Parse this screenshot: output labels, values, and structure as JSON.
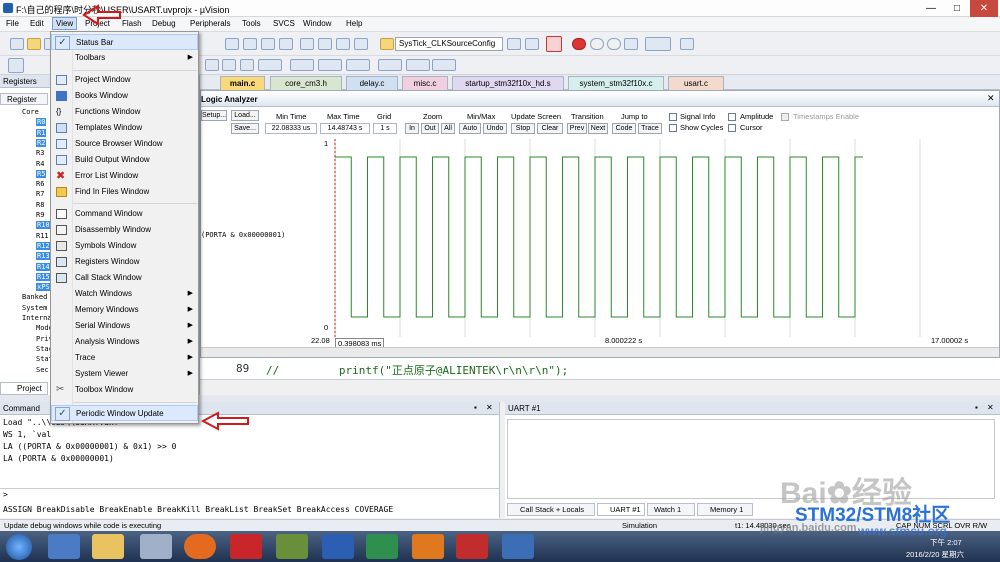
{
  "window": {
    "title": "F:\\自己的程序\\时分秒\\USER\\USART.uvprojx - µVision"
  },
  "menubar": [
    "File",
    "Edit",
    "View",
    "Project",
    "Flash",
    "Debug",
    "Peripherals",
    "Tools",
    "SVCS",
    "Window",
    "Help"
  ],
  "toolbar": {
    "target_combo": "SysTick_CLKSourceConfig"
  },
  "registers": {
    "header": "Registers",
    "column": "Register",
    "rows": [
      "Core",
      "R0",
      "R1",
      "R2",
      "R3",
      "R4",
      "R5",
      "R6",
      "R7",
      "R8",
      "R9",
      "R10",
      "R11",
      "R12",
      "R13",
      "R14",
      "R15",
      "xPSR",
      "Banked",
      "System",
      "Internal",
      "Mode",
      "Priv",
      "Stack",
      "Stat",
      "Sec"
    ],
    "project_tab": "Project"
  },
  "file_tabs": [
    "main.c",
    "core_cm3.h",
    "delay.c",
    "misc.c",
    "startup_stm32f10x_hd.s",
    "system_stm32f10x.c",
    "usart.c"
  ],
  "logic_analyzer": {
    "title": "Logic Analyzer",
    "setup": "Setup...",
    "load": "Load...",
    "save": "Save...",
    "min_time_label": "Min Time",
    "min_time": "22.08333 us",
    "max_time_label": "Max Time",
    "max_time": "14.48743 s",
    "grid_label": "Grid",
    "grid": "1 s",
    "zoom_label": "Zoom",
    "zoom_in": "In",
    "zoom_out": "Out",
    "zoom_all": "All",
    "minmax_label": "Min/Max",
    "auto": "Auto",
    "undo": "Undo",
    "update_label": "Update Screen",
    "stop": "Stop",
    "clear": "Clear",
    "transition_label": "Transition",
    "prev": "Prev",
    "next": "Next",
    "jump_label": "Jump to",
    "code": "Code",
    "trace": "Trace",
    "signal_info": "Signal Info",
    "show_cycles": "Show Cycles",
    "amplitude": "Amplitude",
    "cursor": "Cursor",
    "timestamps": "Timestamps Enable",
    "signal_name": "(PORTA & 0x00000001)",
    "y_high": "1",
    "y_low": "0",
    "x_start": "22.08",
    "x_cursor": "0.398083 ms",
    "x_mid": "8.000222 s",
    "x_end": "17.00002 s"
  },
  "code": {
    "line_no": "89",
    "text": "//         printf(\"正点原子@ALIENTEK\\r\\n\\r\\n\");"
  },
  "command": {
    "header": "Command",
    "lines": [
      "Load \"..\\\\OBJ\\\\USART.axf\"",
      "WS 1, `val",
      "LA ((PORTA & 0x00000001) & 0x1) >> 0",
      "LA (PORTA & 0x00000001)"
    ],
    "prompt": ">",
    "autocomplete": "ASSIGN BreakDisable BreakEnable BreakKill BreakList BreakSet BreakAccess COVERAGE"
  },
  "uart": {
    "header": "UART #1",
    "tabs": [
      "Call Stack + Locals",
      "UART #1",
      "Watch 1",
      "Memory 1"
    ]
  },
  "status": {
    "hint": "Update debug windows while code is executing",
    "mode": "Simulation",
    "time": "t1: 14.48030 sec",
    "flags": "CAP NUM SCRL OVR R/W"
  },
  "taskbar": {
    "clock_time": "下午 2:07",
    "clock_date": "2016/2/20 星期六"
  },
  "view_menu": {
    "items": [
      {
        "label": "Status Bar",
        "checked": true
      },
      {
        "label": "Toolbars",
        "submenu": true
      },
      {
        "label": "Project Window"
      },
      {
        "label": "Books Window"
      },
      {
        "label": "Functions Window"
      },
      {
        "label": "Templates Window"
      },
      {
        "label": "Source Browser Window"
      },
      {
        "label": "Build Output Window"
      },
      {
        "label": "Error List Window"
      },
      {
        "label": "Find In Files Window"
      },
      {
        "label": "Command Window"
      },
      {
        "label": "Disassembly Window"
      },
      {
        "label": "Symbols Window"
      },
      {
        "label": "Registers Window"
      },
      {
        "label": "Call Stack Window"
      },
      {
        "label": "Watch Windows",
        "submenu": true
      },
      {
        "label": "Memory Windows",
        "submenu": true
      },
      {
        "label": "Serial Windows",
        "submenu": true
      },
      {
        "label": "Analysis Windows",
        "submenu": true
      },
      {
        "label": "Trace",
        "submenu": true
      },
      {
        "label": "System Viewer",
        "submenu": true
      },
      {
        "label": "Toolbox Window"
      },
      {
        "label": "Periodic Window Update",
        "checked": true
      }
    ]
  },
  "watermark": {
    "brand": "Bai",
    "brand2": "经验",
    "site": "STM32/STM8社区",
    "url": "jingyan.baidu.com",
    "url2": "www.stmcu.org"
  },
  "colors": {
    "signal": "#2a8a2a",
    "menu_highlight": "#dce8fb",
    "register_select": "#3a8ee6",
    "annotation_arrow": "#d21919"
  }
}
